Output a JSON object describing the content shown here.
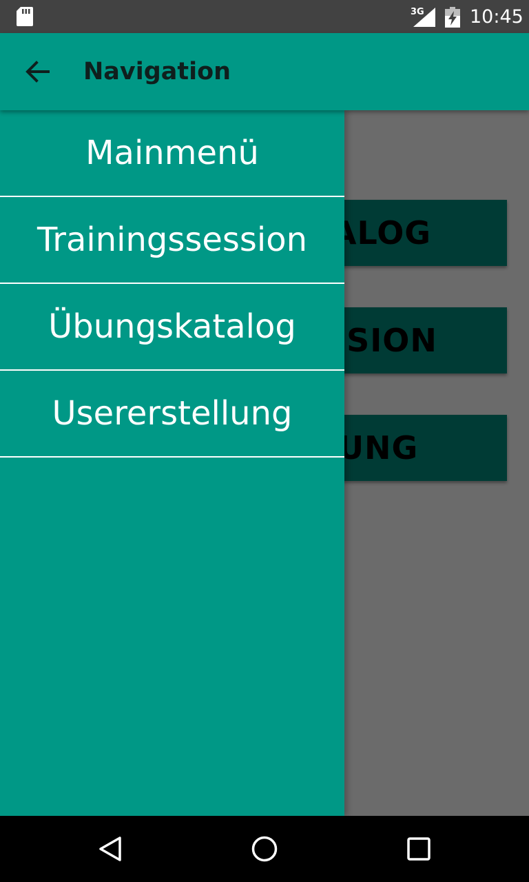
{
  "status_bar": {
    "network": "3G",
    "time": "10:45",
    "icons": [
      "sd-card-icon",
      "cellular-signal-icon",
      "battery-charging-icon"
    ]
  },
  "app_bar": {
    "title": "Navigation",
    "back_icon": "arrow-back-icon"
  },
  "drawer": {
    "items": [
      {
        "label": "Mainmenü"
      },
      {
        "label": "Trainingssession"
      },
      {
        "label": "Übungskatalog"
      },
      {
        "label": "Usererstellung"
      }
    ]
  },
  "background_buttons": [
    {
      "visible_text": "ALOG"
    },
    {
      "visible_text": "SION"
    },
    {
      "visible_text": "UNG"
    }
  ],
  "nav_bar": {
    "icons": [
      "nav-back-icon",
      "nav-home-icon",
      "nav-recents-icon"
    ]
  },
  "colors": {
    "primary": "#009886",
    "status_bar": "#424242",
    "scrim": "#6b6b6b",
    "button_dark": "#003b35",
    "divider": "#ffffff"
  }
}
